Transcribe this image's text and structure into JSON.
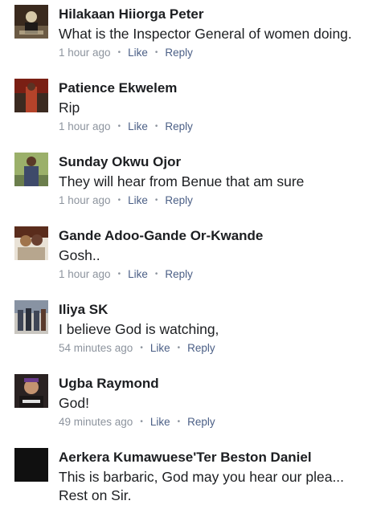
{
  "comments": [
    {
      "name": "Hilakaan Hiiorga Peter",
      "text": "What is the Inspector General of women doing.",
      "time": "1 hour ago",
      "like": "Like",
      "reply": "Reply",
      "avatar_colors": [
        "#3a2a1e",
        "#6b5a44",
        "#d7c9a8"
      ]
    },
    {
      "name": "Patience Ekwelem",
      "text": "Rip",
      "time": "1 hour ago",
      "like": "Like",
      "reply": "Reply",
      "avatar_colors": [
        "#7a1f14",
        "#b4432a",
        "#3b2a20"
      ]
    },
    {
      "name": "Sunday Okwu Ojor",
      "text": "They will hear from Benue that am sure",
      "time": "1 hour ago",
      "like": "Like",
      "reply": "Reply",
      "avatar_colors": [
        "#9bb06a",
        "#6b7e4c",
        "#3e4a6a"
      ]
    },
    {
      "name": "Gande Adoo-Gande Or-Kwande",
      "text": "Gosh..",
      "time": "1 hour ago",
      "like": "Like",
      "reply": "Reply",
      "avatar_colors": [
        "#5a2c1c",
        "#a0744c",
        "#e9e2d6"
      ]
    },
    {
      "name": "Iliya SK",
      "text": "I believe God is watching,",
      "time": "54 minutes ago",
      "like": "Like",
      "reply": "Reply",
      "avatar_colors": [
        "#8893a3",
        "#3f4656",
        "#c9c6c0"
      ]
    },
    {
      "name": "Ugba Raymond",
      "text": "God!",
      "time": "49 minutes ago",
      "like": "Like",
      "reply": "Reply",
      "avatar_colors": [
        "#2a2222",
        "#6a3b8c",
        "#c49370"
      ]
    },
    {
      "name": "Aerkera Kumawuese'Ter Beston Daniel",
      "text": "This is barbaric, God may you hear our plea...",
      "text2": "Rest on Sir.",
      "avatar_colors": [
        "#101010",
        "#101010",
        "#101010"
      ]
    }
  ]
}
